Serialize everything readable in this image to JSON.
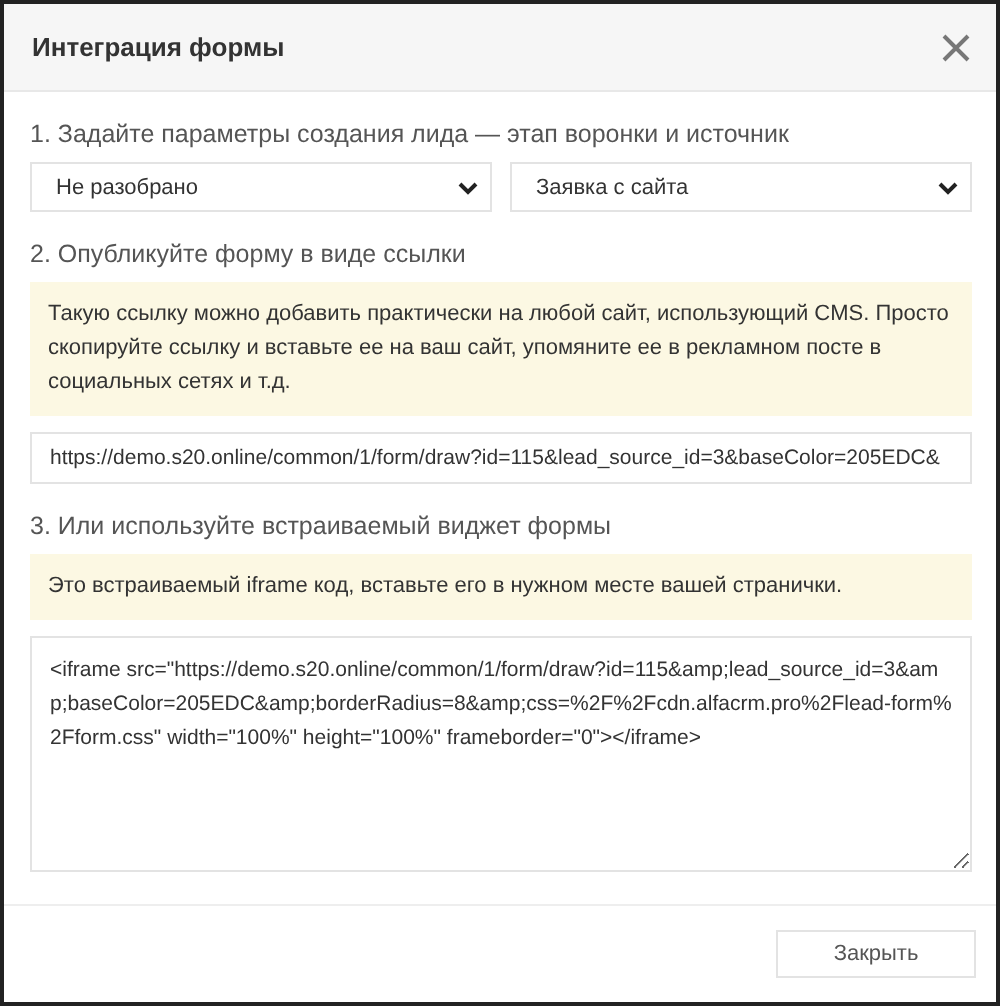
{
  "dialog": {
    "title": "Интеграция формы"
  },
  "step1": {
    "heading": "1. Задайте параметры создания лида — этап воронки и источник",
    "selects": [
      {
        "value": "Не разобрано"
      },
      {
        "value": "Заявка с сайта"
      }
    ]
  },
  "step2": {
    "heading": "2. Опубликуйте форму в виде ссылки",
    "note": "Такую ссылку можно добавить практически на любой сайт, использующий CMS. Просто скопируйте ссылку и вставьте ее на ваш сайт, упомяните ее в рекламном посте в социальных сетях и т.д.",
    "link": "https://demo.s20.online/common/1/form/draw?id=115&lead_source_id=3&baseColor=205EDC&"
  },
  "step3": {
    "heading": "3. Или используйте встраиваемый виджет формы",
    "note": "Это встраиваемый iframe код, вставьте его в нужном месте вашей странички.",
    "code": "<iframe src=\"https://demo.s20.online/common/1/form/draw?id=115&amp;lead_source_id=3&amp;baseColor=205EDC&amp;borderRadius=8&amp;css=%2F%2Fcdn.alfacrm.pro%2Flead-form%2Fform.css\" width=\"100%\" height=\"100%\" frameborder=\"0\"></iframe>"
  },
  "footer": {
    "close_button": "Закрыть"
  }
}
